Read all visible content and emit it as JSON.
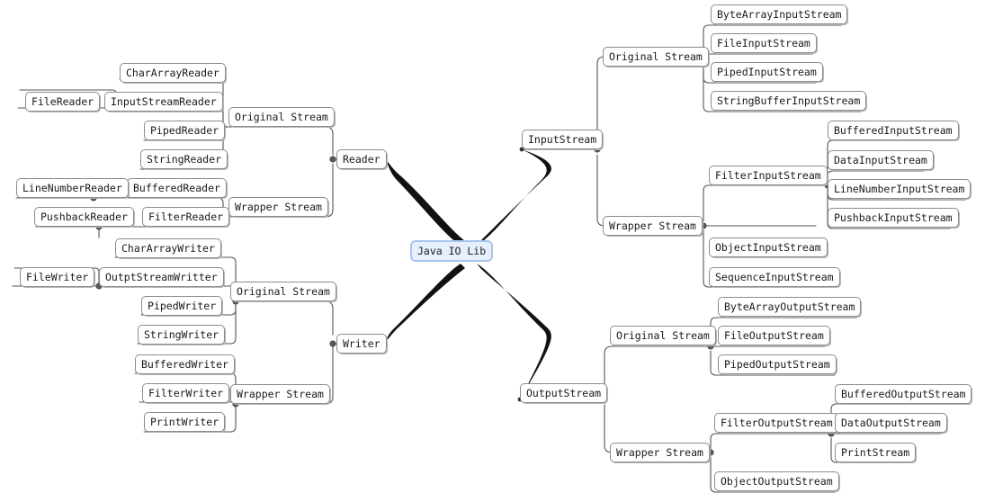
{
  "diagram": {
    "title": "Java IO Lib",
    "type": "mind-map",
    "root": "Java IO Lib",
    "colors": {
      "root_fill": "#e6effc",
      "root_border": "#a9c6f0",
      "node_fill": "#ffffff",
      "node_border": "#8c8c8c",
      "edge": "#555555",
      "main_branch": "#111111",
      "junction_dot": "#555555",
      "background": "#ffffff"
    }
  },
  "nodes": {
    "root": "Java IO Lib",
    "reader": "Reader",
    "reader_original": "Original Stream",
    "reader_original_children": [
      "CharArrayReader",
      "InputStreamReader",
      "PipedReader",
      "StringReader"
    ],
    "input_stream_reader_child": "FileReader",
    "reader_wrapper": "Wrapper Stream",
    "reader_wrapper_children": [
      "BufferedReader",
      "FilterReader"
    ],
    "buffered_reader_child": "LineNumberReader",
    "filter_reader_child": "PushbackReader",
    "writer": "Writer",
    "writer_original": "Original Stream",
    "writer_original_children": [
      "CharArrayWriter",
      "OutptStreamWritter",
      "PipedWriter",
      "StringWriter"
    ],
    "output_stream_writer_child": "FileWriter",
    "writer_wrapper": "Wrapper Stream",
    "writer_wrapper_children": [
      "BufferedWriter",
      "FilterWriter",
      "PrintWriter"
    ],
    "input_stream": "InputStream",
    "input_original": "Original Stream",
    "input_original_children": [
      "ByteArrayInputStream",
      "FileInputStream",
      "PipedInputStream",
      "StringBufferInputStream"
    ],
    "input_wrapper": "Wrapper Stream",
    "input_wrapper_children": [
      "FilterInputStream",
      "ObjectInputStream",
      "SequenceInputStream"
    ],
    "filter_input_children": [
      "BufferedInputStream",
      "DataInputStream",
      "LineNumberInputStream",
      "PushbackInputStream"
    ],
    "output_stream": "OutputStream",
    "output_original": "Original Stream",
    "output_original_children": [
      "ByteArrayOutputStream",
      "FileOutputStream",
      "PipedOutputStream"
    ],
    "output_wrapper": "Wrapper Stream",
    "output_wrapper_children": [
      "FilterOutputStream",
      "ObjectOutputStream"
    ],
    "filter_output_children": [
      "BufferedOutputStream",
      "DataOutputStream",
      "PrintStream"
    ]
  }
}
